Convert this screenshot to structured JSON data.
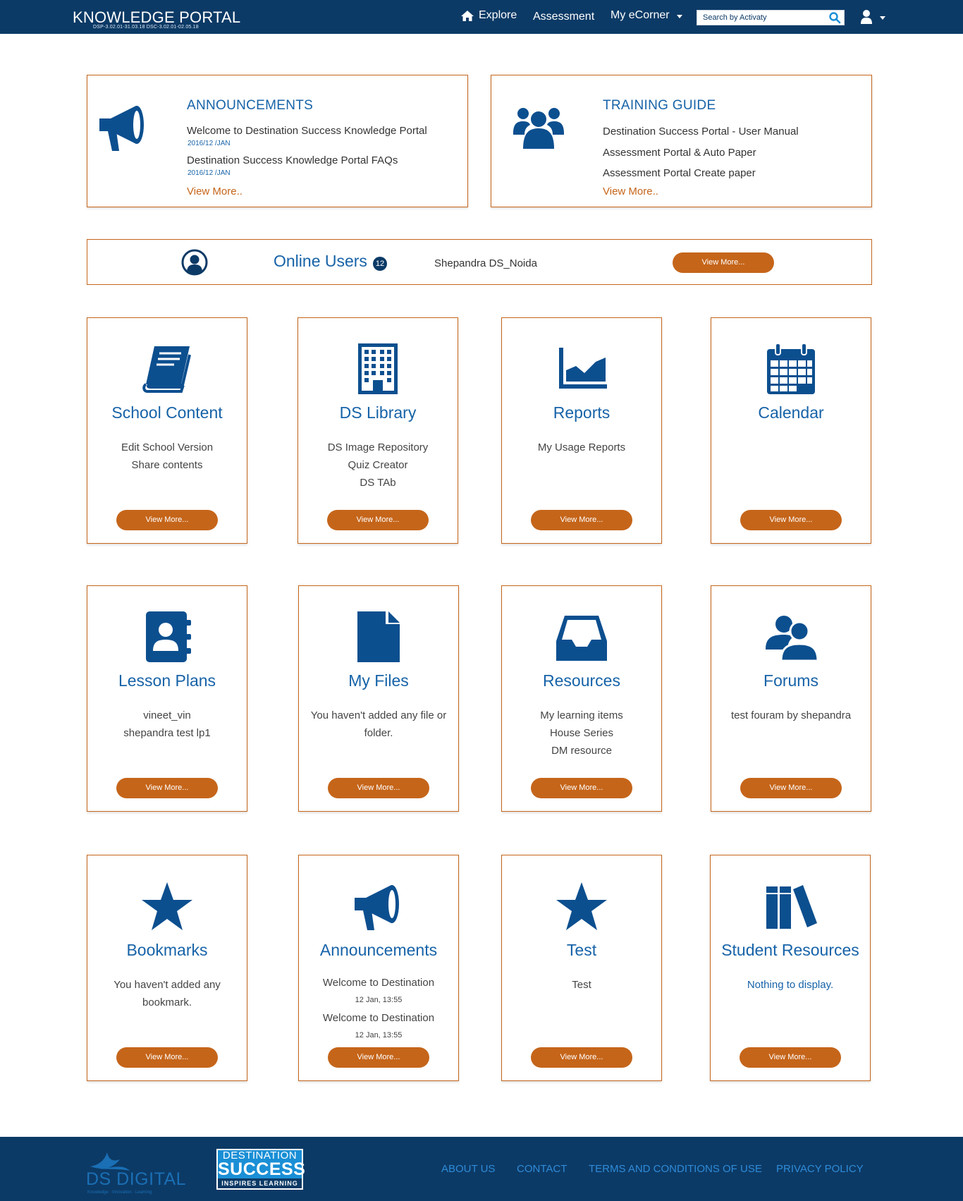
{
  "header": {
    "brand": "KNOWLEDGE PORTAL",
    "version": "DSP-3.02.01-31.03.18 DSC-3.02.01-02.05.18",
    "nav": {
      "explore": "Explore",
      "assessment": "Assessment",
      "ecorner": "My eCorner"
    },
    "search_placeholder": "Search by Activaty"
  },
  "announcements_panel": {
    "title": "ANNOUNCEMENTS",
    "items": [
      {
        "text": "Welcome to Destination Success Knowledge Portal",
        "date": "2016/12 /JAN"
      },
      {
        "text": "Destination Success Knowledge Portal FAQs",
        "date": "2016/12 /JAN"
      }
    ],
    "more": "View  More.."
  },
  "training_panel": {
    "title": "TRAINING GUIDE",
    "items": [
      "Destination Success Portal - User Manual",
      "Assessment Portal & Auto Paper",
      "Assessment Portal Create paper"
    ],
    "more": "View More.."
  },
  "online_users": {
    "title": "Online Users",
    "count": "12",
    "user": "Shepandra DS_Noida",
    "button": "View More..."
  },
  "cards": [
    {
      "title": "School Content",
      "lines": [
        "Edit School Version",
        "Share contents"
      ],
      "button": "View More...",
      "icon": "book-icon"
    },
    {
      "title": "DS Library",
      "lines": [
        "DS Image Repository",
        "Quiz Creator",
        "DS TAb"
      ],
      "button": "View More...",
      "icon": "building-icon"
    },
    {
      "title": "Reports",
      "lines": [
        "My Usage Reports"
      ],
      "button": "View More...",
      "icon": "area-chart-icon"
    },
    {
      "title": "Calendar",
      "lines": [],
      "button": "View More...",
      "icon": "calendar-icon"
    },
    {
      "title": "Lesson Plans",
      "lines": [
        "vineet_vin",
        "shepandra test lp1"
      ],
      "button": "View More...",
      "icon": "contact-book-icon"
    },
    {
      "title": "My Files",
      "lines": [
        "You haven't added any file or folder."
      ],
      "button": "View More...",
      "icon": "file-icon"
    },
    {
      "title": "Resources",
      "lines": [
        "My learning items",
        "House Series",
        "DM resource"
      ],
      "button": "View More...",
      "icon": "inbox-icon"
    },
    {
      "title": "Forums",
      "lines": [
        "test fouram by shepandra"
      ],
      "button": "View More...",
      "icon": "users-icon"
    },
    {
      "title": "Bookmarks",
      "lines": [
        "You haven't added any bookmark."
      ],
      "button": "View More...",
      "icon": "star-icon"
    },
    {
      "title": "Announcements",
      "lines": [
        "Welcome to Destination",
        "12 Jan, 13:55",
        "Welcome to Destination",
        "12 Jan, 13:55"
      ],
      "button": "View More...",
      "icon": "megaphone-icon"
    },
    {
      "title": "Test",
      "lines": [
        "Test"
      ],
      "button": "View More...",
      "icon": "star-icon"
    },
    {
      "title": "Student Resources",
      "lines": [
        "Nothing to display."
      ],
      "button": "View More...",
      "icon": "books-icon"
    }
  ],
  "footer": {
    "logo1_text": "DS DIGITAL",
    "logo1_tagline": "Knowledge · Innovation · Learning",
    "logo2": {
      "line1": "DESTINATION",
      "line2": "SUCCESS",
      "line3": "INSPIRES LEARNING"
    },
    "links": [
      "ABOUT US",
      "CONTACT",
      "TERMS AND CONDITIONS OF USE",
      "PRIVACY POLICY"
    ]
  },
  "colors": {
    "navy": "#0c3a66",
    "blue": "#1763a8",
    "orange": "#c5651a"
  }
}
